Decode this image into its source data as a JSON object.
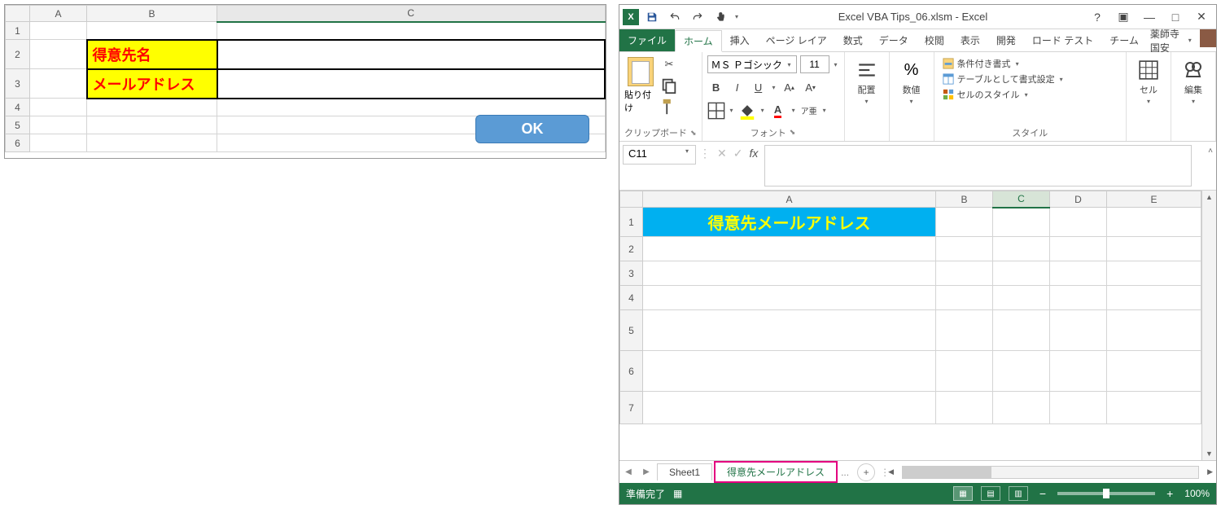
{
  "left": {
    "cols": [
      "A",
      "B",
      "C"
    ],
    "rows": [
      "1",
      "2",
      "3",
      "4",
      "5",
      "6"
    ],
    "b2": "得意先名",
    "b3": "メールアドレス",
    "ok": "OK"
  },
  "titlebar": {
    "title": "Excel VBA Tips_06.xlsm - Excel"
  },
  "tabs": {
    "file": "ファイル",
    "home": "ホーム",
    "insert": "挿入",
    "pagelayout": "ページ レイア",
    "formulas": "数式",
    "data": "データ",
    "review": "校閲",
    "view": "表示",
    "developer": "開発",
    "loadtest": "ロード テスト",
    "team": "チーム",
    "signin": "薬師寺国安"
  },
  "ribbon": {
    "clipboard": {
      "paste": "貼り付け",
      "label": "クリップボード"
    },
    "font": {
      "name": "ＭＳ Ｐゴシック",
      "size": "11",
      "label": "フォント",
      "ruby": "ア亜"
    },
    "align": {
      "label": "配置"
    },
    "number": {
      "label": "数値"
    },
    "styles": {
      "conditional": "条件付き書式",
      "table": "テーブルとして書式設定",
      "cell": "セルのスタイル",
      "label": "スタイル"
    },
    "cells": {
      "label": "セル"
    },
    "edit": {
      "label": "編集"
    }
  },
  "namebox": "C11",
  "fx_label": "fx",
  "grid": {
    "cols": [
      "A",
      "B",
      "C",
      "D",
      "E"
    ],
    "rows": [
      "1",
      "2",
      "3",
      "4",
      "5",
      "6",
      "7"
    ],
    "a1": "得意先メールアドレス"
  },
  "sheets": {
    "sheet1": "Sheet1",
    "sheet2": "得意先メールアドレス",
    "dots": "..."
  },
  "status": {
    "ready": "準備完了",
    "zoom": "100%"
  }
}
